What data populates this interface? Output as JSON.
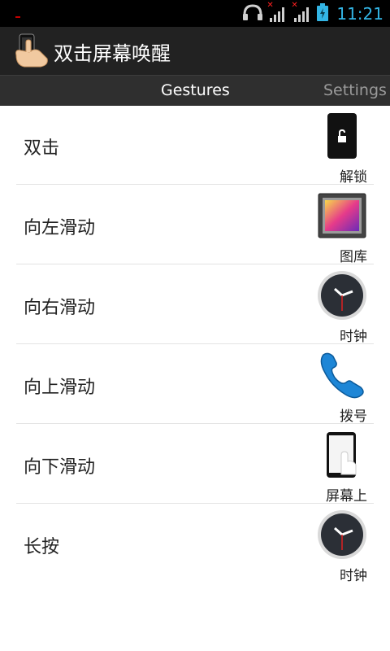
{
  "status_bar": {
    "time": "11:21",
    "icons": [
      "headphones-icon",
      "signal-icon",
      "signal-icon",
      "battery-charging-icon"
    ]
  },
  "app": {
    "title": "双击屏幕唤醒",
    "icon": "hand-phone-icon"
  },
  "tabs": [
    {
      "label": "Gestures",
      "selected": true
    },
    {
      "label": "Settings",
      "selected": false
    }
  ],
  "gestures": [
    {
      "label": "双击",
      "app": "解锁",
      "icon": "unlock-phone-icon"
    },
    {
      "label": "向左滑动",
      "app": "图库",
      "icon": "gallery-icon"
    },
    {
      "label": "向右滑动",
      "app": "时钟",
      "icon": "clock-icon"
    },
    {
      "label": "向上滑动",
      "app": "拨号",
      "icon": "phone-icon"
    },
    {
      "label": "向下滑动",
      "app": "屏幕上",
      "icon": "screen-on-icon"
    },
    {
      "label": "长按",
      "app": "时钟",
      "icon": "clock-icon"
    }
  ],
  "colors": {
    "accent": "#33b5e5",
    "action_bar": "#222222",
    "tab_bar": "#2f2f2f"
  }
}
